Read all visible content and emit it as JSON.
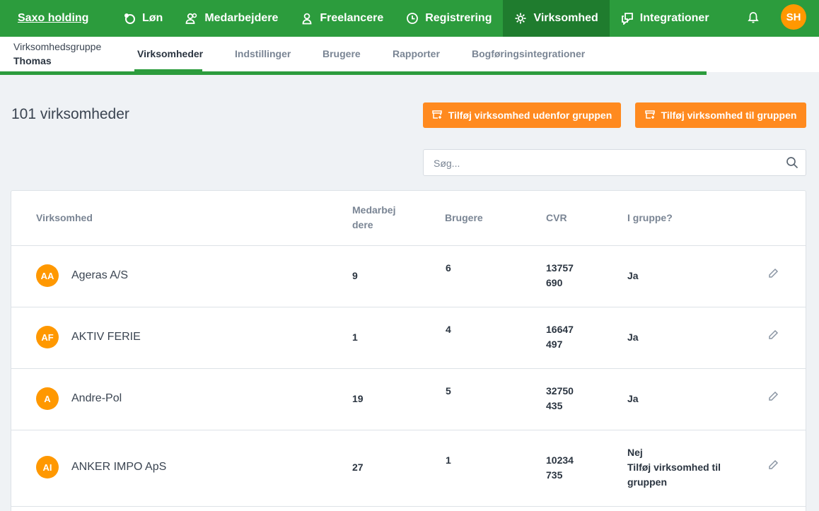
{
  "topnav": {
    "brand": "Saxo holding",
    "items": [
      {
        "label": "Løn",
        "icon": "money-icon"
      },
      {
        "label": "Medarbejdere",
        "icon": "people-icon"
      },
      {
        "label": "Freelancere",
        "icon": "person-icon"
      },
      {
        "label": "Registrering",
        "icon": "clock-icon"
      },
      {
        "label": "Virksomhed",
        "icon": "gear-icon",
        "active": true
      },
      {
        "label": "Integrationer",
        "icon": "chat-icon"
      }
    ],
    "avatar_initials": "SH"
  },
  "subnav": {
    "group_caption": "Virksomhedsgruppe",
    "group_name": "Thomas",
    "tabs": [
      "Virksomheder",
      "Indstillinger",
      "Brugere",
      "Rapporter",
      "Bogføringsintegrationer"
    ],
    "active_tab": "Virksomheder"
  },
  "main": {
    "count_label": "101 virksomheder",
    "btn_outside": "Tilføj virksomhed udenfor gruppen",
    "btn_inside": "Tilføj virksomhed til gruppen",
    "search_placeholder": "Søg..."
  },
  "table": {
    "headers": {
      "company": "Virksomhed",
      "employees_1": "Medarbej",
      "employees_2": "dere",
      "users": "Brugere",
      "cvr": "CVR",
      "in_group": "I gruppe?"
    },
    "rows": [
      {
        "initials": "AA",
        "name": "Ageras A/S",
        "employees": "9",
        "users": "6",
        "cvr_1": "13757",
        "cvr_2": "690",
        "in_group_1": "Ja",
        "in_group_2": "",
        "in_group_3": ""
      },
      {
        "initials": "AF",
        "name": "AKTIV FERIE",
        "employees": "1",
        "users": "4",
        "cvr_1": "16647",
        "cvr_2": "497",
        "in_group_1": "Ja",
        "in_group_2": "",
        "in_group_3": ""
      },
      {
        "initials": "A",
        "name": "Andre-Pol",
        "employees": "19",
        "users": "5",
        "cvr_1": "32750",
        "cvr_2": "435",
        "in_group_1": "Ja",
        "in_group_2": "",
        "in_group_3": ""
      },
      {
        "initials": "AI",
        "name": "ANKER IMPO ApS",
        "employees": "27",
        "users": "1",
        "cvr_1": "10234",
        "cvr_2": "735",
        "in_group_1": "Nej",
        "in_group_2": "Tilføj virksomhed til",
        "in_group_3": "gruppen"
      }
    ]
  },
  "colors": {
    "brand_green": "#2c9c3d",
    "active_green": "#1f7c2e",
    "accent_orange": "#ff8a1f",
    "avatar_orange": "#ff9800"
  }
}
